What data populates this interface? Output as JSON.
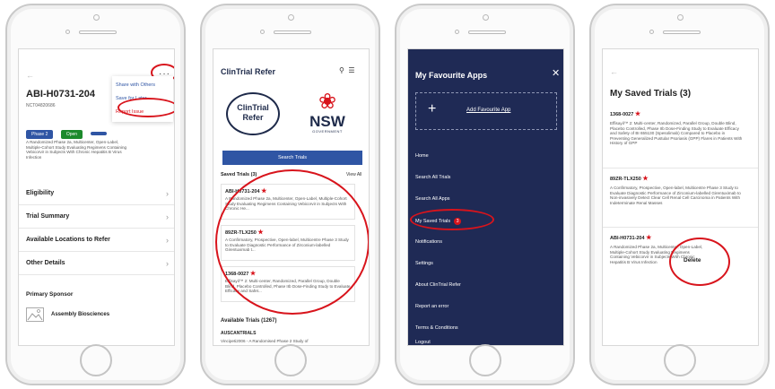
{
  "screen1": {
    "title": "ABI-H0731-204",
    "nct": "NCT04820686",
    "menu": [
      "Share with Others",
      "Save for Later",
      "Report Issue"
    ],
    "badges": [
      {
        "label": "Phase 2",
        "color": "#2f55a4"
      },
      {
        "label": "Open",
        "color": "#1c8a2c"
      },
      {
        "label": "",
        "color": "#2f55a4"
      }
    ],
    "description": "A Randomized Phase 2a, Multicenter, Open-Label, Multiple-Cohort Study Evaluating Regimens Containing Vebicorvir in Subjects With Chronic Hepatitis B Virus Infection",
    "rows": [
      "Eligibility",
      "Trial Summary",
      "Available Locations to Refer",
      "Other Details"
    ],
    "sponsor_heading": "Primary Sponsor",
    "sponsor": "Assembly Biosciences"
  },
  "screen2": {
    "app_title": "ClinTrial Refer",
    "logo_line1": "ClinTrial",
    "logo_line2": "Refer",
    "nsw": "NSW",
    "government": "GOVERNMENT",
    "search_button": "Search Trials",
    "saved_heading": "Saved Trials (3)",
    "view_all": "View All",
    "cards": [
      {
        "id": "ABI-H0731-204",
        "desc": "A Randomized Phase 2a, Multicenter, Open-Label, Multiple-Cohort Study Evaluating Regimens Containing Vebicorvir in Subjects With Chronic He..."
      },
      {
        "id": "89ZR-TLX250",
        "desc": "A Confirmatory, Prospective, Open-label, Multicentre Phase 3 Study to Evaluate Diagnostic Performance of Zirconium-labelled Girentuximab t..."
      },
      {
        "id": "1368-0027",
        "desc": "Effisayil™ 2: Multi-center, Randomized, Parallel Group, Double Blind, Placebo Controlled, Phase IIb Dose-Finding Study to Evaluate Efficacy and Safet..."
      }
    ],
    "available_heading": "Available Trials (1267)",
    "available_first": "AUSCANTRIALS",
    "available_first_desc": "Vincipeti2006 - A Randomised Phase 2 Study of"
  },
  "screen3": {
    "title": "My Favourite Apps",
    "add_label": "Add Favourite App",
    "menu": [
      "Home",
      "Search All Trials",
      "Search All Apps",
      "My Saved Trials",
      "Notifications",
      "Settings",
      "About ClinTrial Refer",
      "Report an error",
      "Terms & Conditions",
      "Logout"
    ],
    "saved_count": "3"
  },
  "screen4": {
    "title": "My Saved Trials (3)",
    "trials": [
      {
        "id": "1368-0027",
        "desc": "Effisayil™ 2: Multi-center, Randomized, Parallel Group, Double Blind, Placebo Controlled, Phase IIb Dose-Finding Study to Evaluate Efficacy and Safety of BI 655130 (Spesolimab) Compared to Placebo in Preventing Generalized Pustular Psoriasis (GPP) Flares in Patients With History of GPP"
      },
      {
        "id": "89ZR-TLX250",
        "desc": "A Confirmatory, Prospective, Open-label, Multicentre Phase 3 Study to Evaluate Diagnostic Performance of Zirconium-labelled Girentuximab to Non-invasively Detect Clear Cell Renal Cell Carcinoma in Patients With Indeterminate Renal Masses"
      },
      {
        "id": "ABI-H0731-204",
        "desc": "A Randomized Phase 2a, Multicenter, Open-Label, Multiple-Cohort Study Evaluating Regimens Containing Vebicorvir in Subjects With Chronic Hepatitis B Virus Infection"
      }
    ],
    "delete_label": "Delete"
  },
  "colors": {
    "accent": "#2f55a4",
    "navy": "#1f2a55",
    "highlight": "#d8141c",
    "open": "#1c8a2c"
  }
}
